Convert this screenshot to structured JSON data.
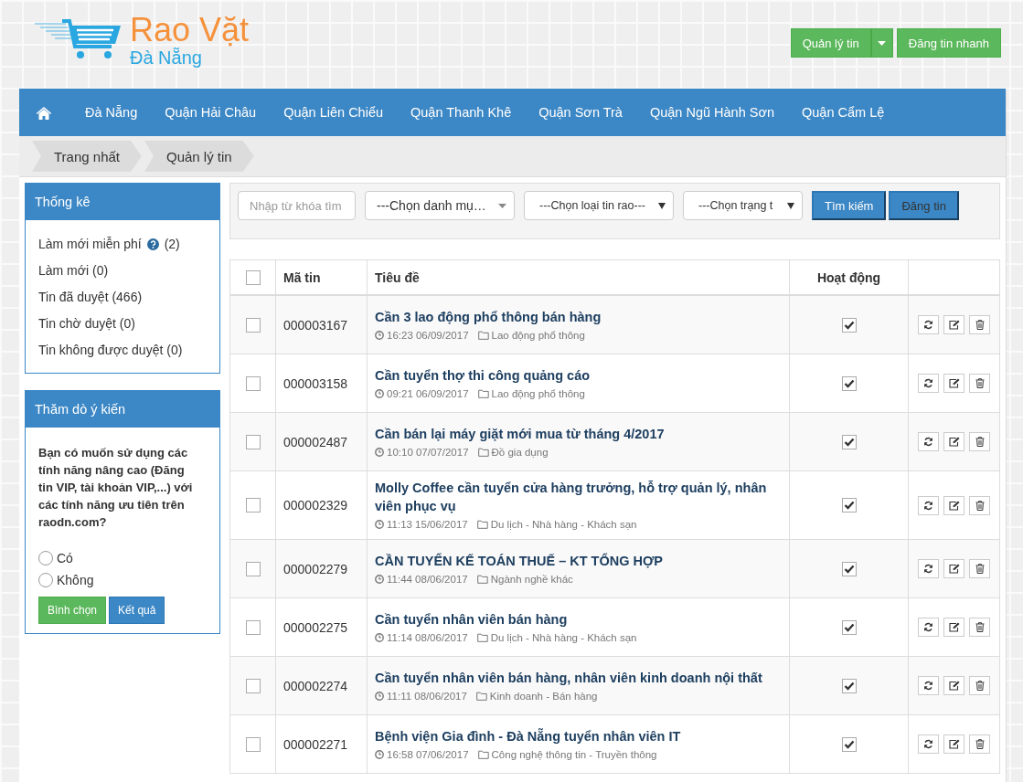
{
  "header": {
    "logo": {
      "title": "Rao Vặt",
      "subtitle": "Đà Nẵng"
    },
    "buttons": [
      {
        "label": "Quản lý tin",
        "split": true
      },
      {
        "label": "Đăng tin nhanh",
        "split": false
      }
    ]
  },
  "nav": {
    "items": [
      "Đà Nẵng",
      "Quận Hải Châu",
      "Quận Liên Chiểu",
      "Quận Thanh Khê",
      "Quận Sơn Trà",
      "Quận Ngũ Hành Sơn",
      "Quận Cẩm Lệ"
    ]
  },
  "breadcrumb": [
    "Trang nhất",
    "Quản lý tin"
  ],
  "stats": {
    "title": "Thống kê",
    "items": [
      {
        "label": "Làm mới miễn phí",
        "help": true,
        "count": "(2)"
      },
      {
        "label": "Làm mới (0)"
      },
      {
        "label": "Tin đã duyệt (466)"
      },
      {
        "label": "Tin chờ duyệt (0)"
      },
      {
        "label": "Tin không được duyệt (0)"
      }
    ]
  },
  "poll": {
    "title": "Thăm dò ý kiến",
    "question": "Bạn có muốn sử dụng các tính năng nâng cao (Đăng tin VIP, tài khoản VIP,...) với các tính năng ưu tiên trên raodn.com?",
    "options": [
      {
        "label": "Có",
        "selected": false
      },
      {
        "label": "Không",
        "selected": false
      }
    ],
    "buttons": [
      {
        "label": "Bình chọn",
        "kind": "success"
      },
      {
        "label": "Kết quả",
        "kind": "primary"
      }
    ]
  },
  "filters": {
    "search": {
      "placeholder": "Nhập từ khóa tìm"
    },
    "selects": [
      {
        "value": "---Chọn danh mụ…",
        "kind": "styled"
      },
      {
        "value": "---Chọn loại tin rao---",
        "kind": "native"
      },
      {
        "value": "---Chọn trạng t",
        "kind": "native"
      }
    ],
    "buttons": [
      {
        "label": "Tìm kiếm",
        "kind": "primary"
      },
      {
        "label": "Đăng tin",
        "kind": "muted"
      }
    ]
  },
  "table": {
    "select_all": {
      "checked": false
    },
    "columns": [
      "Mã tin",
      "Tiêu đề",
      "Hoạt động"
    ],
    "rows": [
      {
        "id": "000003167",
        "title": "Cần 3 lao động phổ thông bán hàng",
        "time": "16:23 06/09/2017",
        "category": "Lao động phổ thông",
        "checked": false,
        "active": true
      },
      {
        "id": "000003158",
        "title": "Cần tuyển thợ thi công quảng cáo",
        "time": "09:21 06/09/2017",
        "category": "Lao động phổ thông",
        "checked": false,
        "active": true
      },
      {
        "id": "000002487",
        "title": "Cần bán lại máy giặt mới mua từ tháng 4/2017",
        "time": "10:10 07/07/2017",
        "category": "Đồ gia dụng",
        "checked": false,
        "active": true
      },
      {
        "id": "000002329",
        "title": "Molly Coffee cần tuyển cửa hàng trưởng, hỗ trợ quản lý, nhân viên phục vụ",
        "time": "11:13 15/06/2017",
        "category": "Du lịch - Nhà hàng - Khách sạn",
        "checked": false,
        "active": true
      },
      {
        "id": "000002279",
        "title": "CẦN TUYỂN KẾ TOÁN THUẾ – KT TỔNG HỢP",
        "time": "11:44 08/06/2017",
        "category": "Ngành nghề khác",
        "checked": false,
        "active": true
      },
      {
        "id": "000002275",
        "title": "Cần tuyển nhân viên bán hàng",
        "time": "11:14 08/06/2017",
        "category": "Du lịch - Nhà hàng - Khách sạn",
        "checked": false,
        "active": true
      },
      {
        "id": "000002274",
        "title": "Cần tuyển nhân viên bán hàng, nhân viên kinh doanh nội thất",
        "time": "11:11 08/06/2017",
        "category": "Kinh doanh - Bán hàng",
        "checked": false,
        "active": true
      },
      {
        "id": "000002271",
        "title": "Bệnh viện Gia đình - Đà Nẵng tuyển nhân viên IT",
        "time": "16:58 07/06/2017",
        "category": "Công nghệ thông tin - Truyền thông",
        "checked": false,
        "active": true
      }
    ]
  }
}
